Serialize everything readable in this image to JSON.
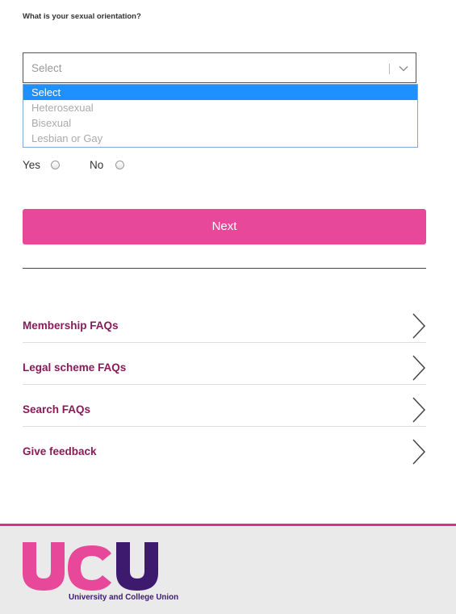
{
  "question": {
    "label": "What is your sexual orientation?"
  },
  "select": {
    "value": "Select",
    "options": [
      "Select",
      "Heterosexual",
      "Bisexual",
      "Lesbian or Gay"
    ]
  },
  "radio": {
    "yes_label": "Yes",
    "no_label": "No"
  },
  "next_button": {
    "label": "Next"
  },
  "faq": {
    "items": [
      {
        "label": "Membership FAQs"
      },
      {
        "label": "Legal scheme FAQs"
      },
      {
        "label": "Search FAQs"
      },
      {
        "label": "Give feedback"
      }
    ]
  },
  "footer": {
    "logo_text": "UCU",
    "org_name": "University and College Union"
  },
  "colors": {
    "accent_pink": "#e8489a",
    "faq_text": "#8b1a5a",
    "logo_pink": "#e8489a",
    "logo_purple": "#3d1a6e",
    "dropdown_highlight": "#1e90ff"
  }
}
